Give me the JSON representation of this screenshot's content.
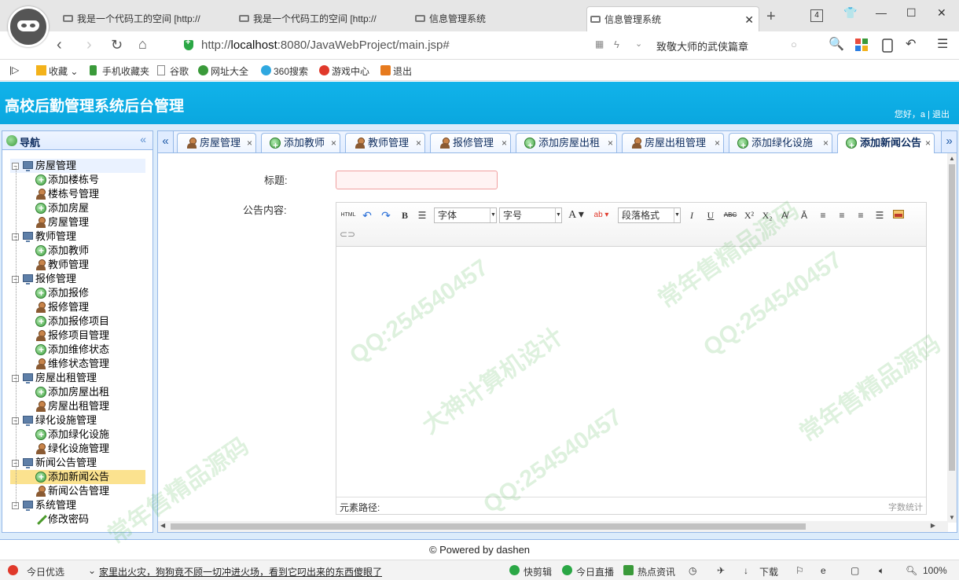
{
  "browser": {
    "tabs": [
      {
        "title": "我是一个代码工的空间 [http://"
      },
      {
        "title": "我是一个代码工的空间 [http://"
      },
      {
        "title": "信息管理系统"
      },
      {
        "title": "信息管理系统"
      }
    ],
    "tab_count": "4",
    "url_prefix": "http://",
    "url_host": "localhost",
    "url_rest": ":8080/JavaWebProject/main.jsp#",
    "search_text": "致敬大师的武侠篇章"
  },
  "favorites": [
    "收藏",
    "手机收藏夹",
    "谷歌",
    "网址大全",
    "360搜索",
    "游戏中心",
    "退出"
  ],
  "app": {
    "title": "高校后勤管理系统后台管理",
    "greeting": "您好，a",
    "separator": " | ",
    "logout": "退出"
  },
  "sidebar": {
    "title": "导航",
    "collapse": "«",
    "groups": [
      {
        "label": "房屋管理",
        "items": [
          {
            "label": "添加楼栋号",
            "icon": "add-icon"
          },
          {
            "label": "楼栋号管理",
            "icon": "user-icon"
          },
          {
            "label": "添加房屋",
            "icon": "add-icon"
          },
          {
            "label": "房屋管理",
            "icon": "user-icon"
          }
        ]
      },
      {
        "label": "教师管理",
        "items": [
          {
            "label": "添加教师",
            "icon": "add-icon"
          },
          {
            "label": "教师管理",
            "icon": "user-icon"
          }
        ]
      },
      {
        "label": "报修管理",
        "items": [
          {
            "label": "添加报修",
            "icon": "add-icon"
          },
          {
            "label": "报修管理",
            "icon": "user-icon"
          },
          {
            "label": "添加报修项目",
            "icon": "add-icon"
          },
          {
            "label": "报修项目管理",
            "icon": "user-icon"
          },
          {
            "label": "添加维修状态",
            "icon": "add-icon"
          },
          {
            "label": "维修状态管理",
            "icon": "user-icon"
          }
        ]
      },
      {
        "label": "房屋出租管理",
        "items": [
          {
            "label": "添加房屋出租",
            "icon": "add-icon"
          },
          {
            "label": "房屋出租管理",
            "icon": "user-icon"
          }
        ]
      },
      {
        "label": "绿化设施管理",
        "items": [
          {
            "label": "添加绿化设施",
            "icon": "add-icon"
          },
          {
            "label": "绿化设施管理",
            "icon": "user-icon"
          }
        ]
      },
      {
        "label": "新闻公告管理",
        "items": [
          {
            "label": "添加新闻公告",
            "icon": "add-icon"
          },
          {
            "label": "新闻公告管理",
            "icon": "user-icon"
          }
        ]
      },
      {
        "label": "系统管理",
        "items": [
          {
            "label": "修改密码",
            "icon": "pencil-icon"
          }
        ]
      }
    ]
  },
  "tabs": [
    {
      "label": "房屋管理",
      "icon": "user-icon"
    },
    {
      "label": "添加教师",
      "icon": "add-icon"
    },
    {
      "label": "教师管理",
      "icon": "user-icon"
    },
    {
      "label": "报修管理",
      "icon": "user-icon"
    },
    {
      "label": "添加房屋出租",
      "icon": "add-icon"
    },
    {
      "label": "房屋出租管理",
      "icon": "user-icon"
    },
    {
      "label": "添加绿化设施",
      "icon": "add-icon"
    },
    {
      "label": "添加新闻公告",
      "icon": "add-icon"
    }
  ],
  "form": {
    "title_label": "标题:",
    "title_value": "",
    "content_label": "公告内容:",
    "toolbar": {
      "html": "HTML",
      "bold": "B",
      "font_family": "字体",
      "font_size": "字号",
      "font_color": "A",
      "paragraph": "段落格式",
      "italic": "I",
      "underline": "U",
      "strike": "ABC",
      "superscript": "X²",
      "subscript": "X₂"
    },
    "path_label": "元素路径:",
    "word_count": "字数统计"
  },
  "footer": "© Powered by dashen",
  "status_bar": {
    "today": "今日优选",
    "news": "家里出火灾，狗狗竟不顾一切冲进火场，看到它叼出来的东西傻眼了",
    "quick_clip": "快剪辑",
    "live": "今日直播",
    "hot": "热点资讯",
    "download": "下载",
    "zoom": "100%"
  },
  "watermark": [
    "QQ:254540457",
    "大神计算机设计",
    "常年售精品源码"
  ]
}
